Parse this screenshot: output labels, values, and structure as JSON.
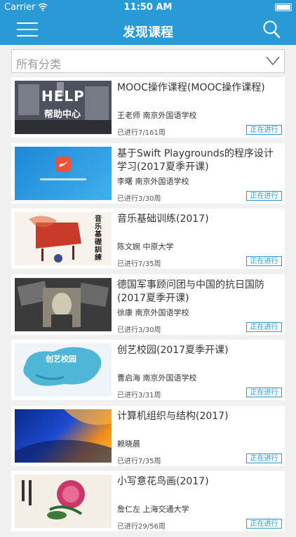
{
  "status_bar": {
    "carrier": "Carrier",
    "time": "11:50 AM"
  },
  "header": {
    "title": "发现课程"
  },
  "filter": {
    "category": "所有分类"
  },
  "courses": [
    {
      "title": "MOOC操作课程(MOOC操作课程)",
      "teacher": "王老师",
      "school": "南京外国语学校",
      "progress": "已进行7/161周",
      "status": "正在进行",
      "thumb_text": [
        "HELP",
        "帮助中心"
      ]
    },
    {
      "title": "基于Swift Playgrounds的程序设计学习(2017夏季开课)",
      "teacher": "李曙",
      "school": "南京外国语学校",
      "progress": "已进行3/30周",
      "status": "正在进行",
      "thumb_text": []
    },
    {
      "title": "音乐基础训练(2017)",
      "teacher": "陈文婉",
      "school": "中原大学",
      "progress": "已进行7/35周",
      "status": "正在进行",
      "thumb_text": [
        "音乐基礎訓練"
      ]
    },
    {
      "title": "德国军事顾问团与中国的抗日国防(2017夏季开课)",
      "teacher": "徐康",
      "school": "南京外国语学校",
      "progress": "已进行3/30周",
      "status": "正在进行",
      "thumb_text": []
    },
    {
      "title": "创艺校园(2017夏季开课)",
      "teacher": "曹启海",
      "school": "南京外国语学校",
      "progress": "已进行3/31周",
      "status": "正在进行",
      "thumb_text": [
        "创艺校园"
      ]
    },
    {
      "title": "计算机组织与结构(2017)",
      "teacher": "赖晓晨",
      "school": "",
      "progress": "已进行7/35周",
      "status": "正在进行",
      "thumb_text": []
    },
    {
      "title": "小写意花鸟画(2017)",
      "teacher": "詹仁左",
      "school": "上海交通大学",
      "progress": "已进行29/56周",
      "status": "正在进行",
      "thumb_text": []
    }
  ],
  "colors": {
    "accent": "#2a9ad6"
  }
}
